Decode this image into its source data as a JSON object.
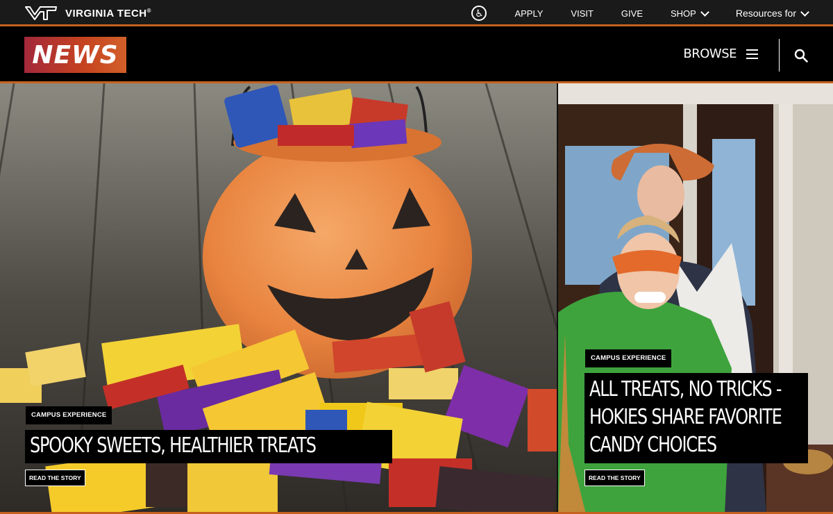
{
  "site": {
    "name": "VIRGINIA TECH",
    "trademark": "®"
  },
  "topnav": {
    "items": [
      {
        "label": "APPLY"
      },
      {
        "label": "VISIT"
      },
      {
        "label": "GIVE"
      },
      {
        "label": "SHOP"
      },
      {
        "label": "Resources for"
      }
    ]
  },
  "newsbar": {
    "logo": "NEWS",
    "browse": "BROWSE"
  },
  "stories": [
    {
      "tag": "CAMPUS EXPERIENCE",
      "headline": "SPOOKY SWEETS, HEALTHIER TREATS",
      "cta": "READ THE STORY",
      "image": "pumpkin-candy-photo"
    },
    {
      "tag": "CAMPUS EXPERIENCE",
      "headline_lines": [
        "ALL TREATS, NO TRICKS -",
        "HOKIES SHARE FAVORITE",
        "CANDY CHOICES"
      ],
      "cta": "READ THE STORY",
      "image": "costumed-couple-photo"
    }
  ],
  "colors": {
    "accent": "#c6611f",
    "maroon": "#861f41",
    "topbar": "#1a1a1a"
  }
}
